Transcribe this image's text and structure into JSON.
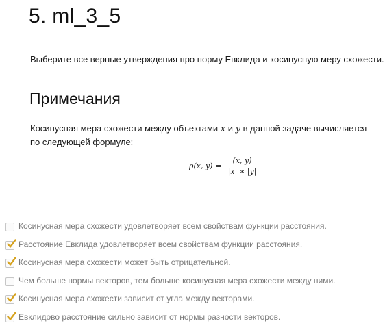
{
  "task": {
    "title": "5. ml_3_5",
    "question": "Выберите все верные утверждения про норму Евклида и косинусную меру схожести."
  },
  "notes": {
    "heading": "Примечания",
    "text_before": "Косинусная мера схожести между объектами ",
    "var_x": "x",
    "text_and": " и ",
    "var_y": "y",
    "text_after": " в данной задаче вычисляется по следующей формуле:",
    "formula": {
      "lhs": "ρ(x, y)",
      "equals": "=",
      "numerator": "(x, y)",
      "denominator": "|x| ∗ |y|"
    }
  },
  "options": [
    {
      "label": "Косинусная мера схожести удовлетворяет всем свойствам функции расстояния.",
      "checked": false
    },
    {
      "label": "Расстояние Евклида удовлетворяет всем свойствам функции расстояния.",
      "checked": true
    },
    {
      "label": "Косинусная мера схожести может быть отрицательной.",
      "checked": true
    },
    {
      "label": "Чем больше нормы векторов, тем больше косинусная мера схожести между ними.",
      "checked": false
    },
    {
      "label": "Косинусная мера схожести зависит от угла между векторами.",
      "checked": true
    },
    {
      "label": "Евклидово расстояние сильно зависит от нормы разности векторов.",
      "checked": true
    }
  ],
  "colors": {
    "checkmark": "#d6a21e",
    "option_text": "#7a7a7a"
  }
}
